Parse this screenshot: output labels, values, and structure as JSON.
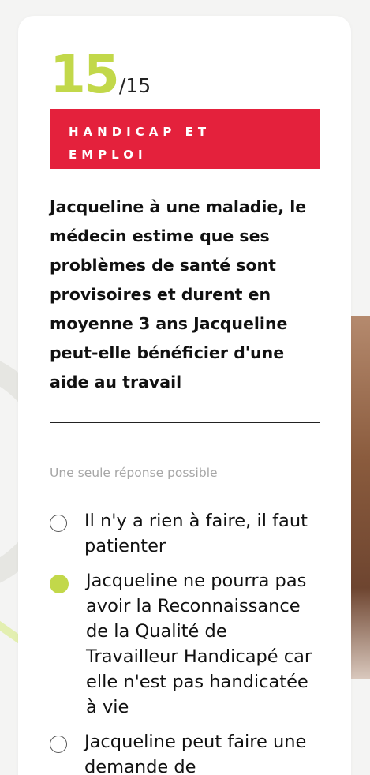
{
  "quiz": {
    "counter": {
      "current": "15",
      "total": "/15"
    },
    "category": {
      "line1": "HANDICAP ET",
      "line2": "EMPLOI"
    },
    "question": "Jacqueline à une maladie, le médecin estime que ses problèmes de santé sont provisoires et durent en moyenne 3 ans Jacqueline peut-elle bénéficier d'une aide au travail",
    "hint": "Une seule réponse possible",
    "options": [
      {
        "label": "Il n'y a rien à faire, il faut patienter",
        "selected": false
      },
      {
        "label": "Jacqueline ne pourra pas avoir la Reconnaissance de la Qualité de Travailleur Handicapé car elle n'est pas handicatée à vie",
        "selected": true
      },
      {
        "label": "Jacqueline peut faire une demande de",
        "selected": false
      }
    ]
  },
  "colors": {
    "accent": "#c2d84a",
    "category_bg": "#e4213c",
    "card_bg": "#ffffff",
    "page_bg": "#f4f4f3"
  }
}
